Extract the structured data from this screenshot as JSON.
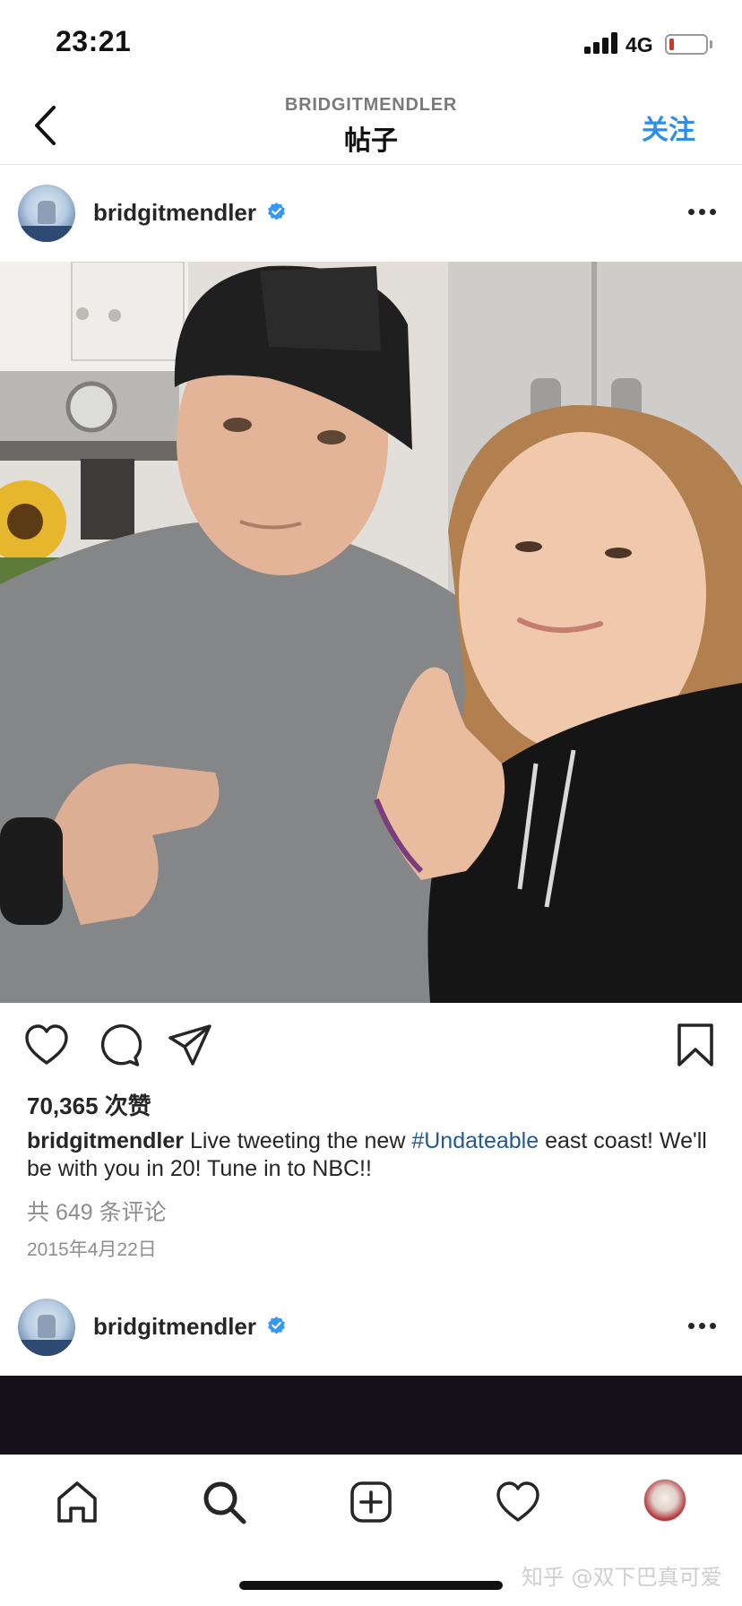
{
  "status_bar": {
    "time": "23:21",
    "network": "4G",
    "battery_level": 0.1,
    "battery_color": "#e0301e"
  },
  "header": {
    "account_name": "BRIDGITMENDLER",
    "title": "帖子",
    "follow_label": "关注",
    "accent_color": "#2f8ee8",
    "back_icon": "chevron-left-icon"
  },
  "post": {
    "username": "bridgitmendler",
    "verified": true,
    "likes_text": "70,365 次赞",
    "caption_user": "bridgitmendler",
    "caption_before": " Live tweeting the new ",
    "caption_hashtag": "#Undateable",
    "caption_after": " east coast! We'll be with you in 20! Tune in to NBC!!",
    "comments_text": "共 649 条评论",
    "date": "2015年4月22日",
    "hashtag_color": "#1f5a94"
  },
  "next_post": {
    "username": "bridgitmendler",
    "verified": true
  },
  "actions": [
    "heart-icon",
    "comment-icon",
    "share-icon",
    "bookmark-icon"
  ],
  "tab_bar": {
    "tabs": [
      "home-icon",
      "search-icon",
      "new-post-icon",
      "activity-icon",
      "profile-avatar"
    ]
  },
  "watermark": "知乎 @双下巴真可爱"
}
